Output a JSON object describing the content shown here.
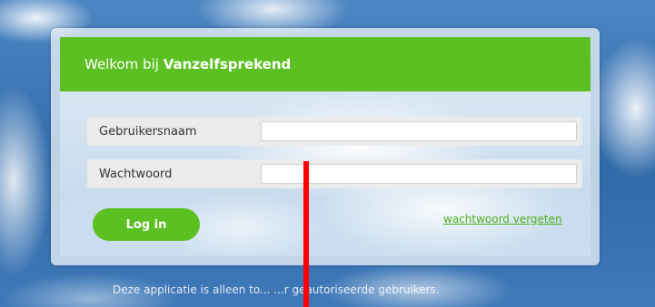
{
  "header": {
    "welcome_prefix": "Welkom bij ",
    "brand": "Vanzelfsprekend"
  },
  "form": {
    "username_label": "Gebruikersnaam",
    "username_value": "",
    "password_label": "Wachtwoord",
    "password_value": "",
    "login_label": "Log in",
    "forgot_label": "wachtwoord vergeten"
  },
  "footer": {
    "notice_visible": "Deze applicatie is alleen to... ...r geautoriseerde gebruikers."
  },
  "colors": {
    "accent_green": "#5cc022",
    "annotation_red": "#ff0000"
  }
}
